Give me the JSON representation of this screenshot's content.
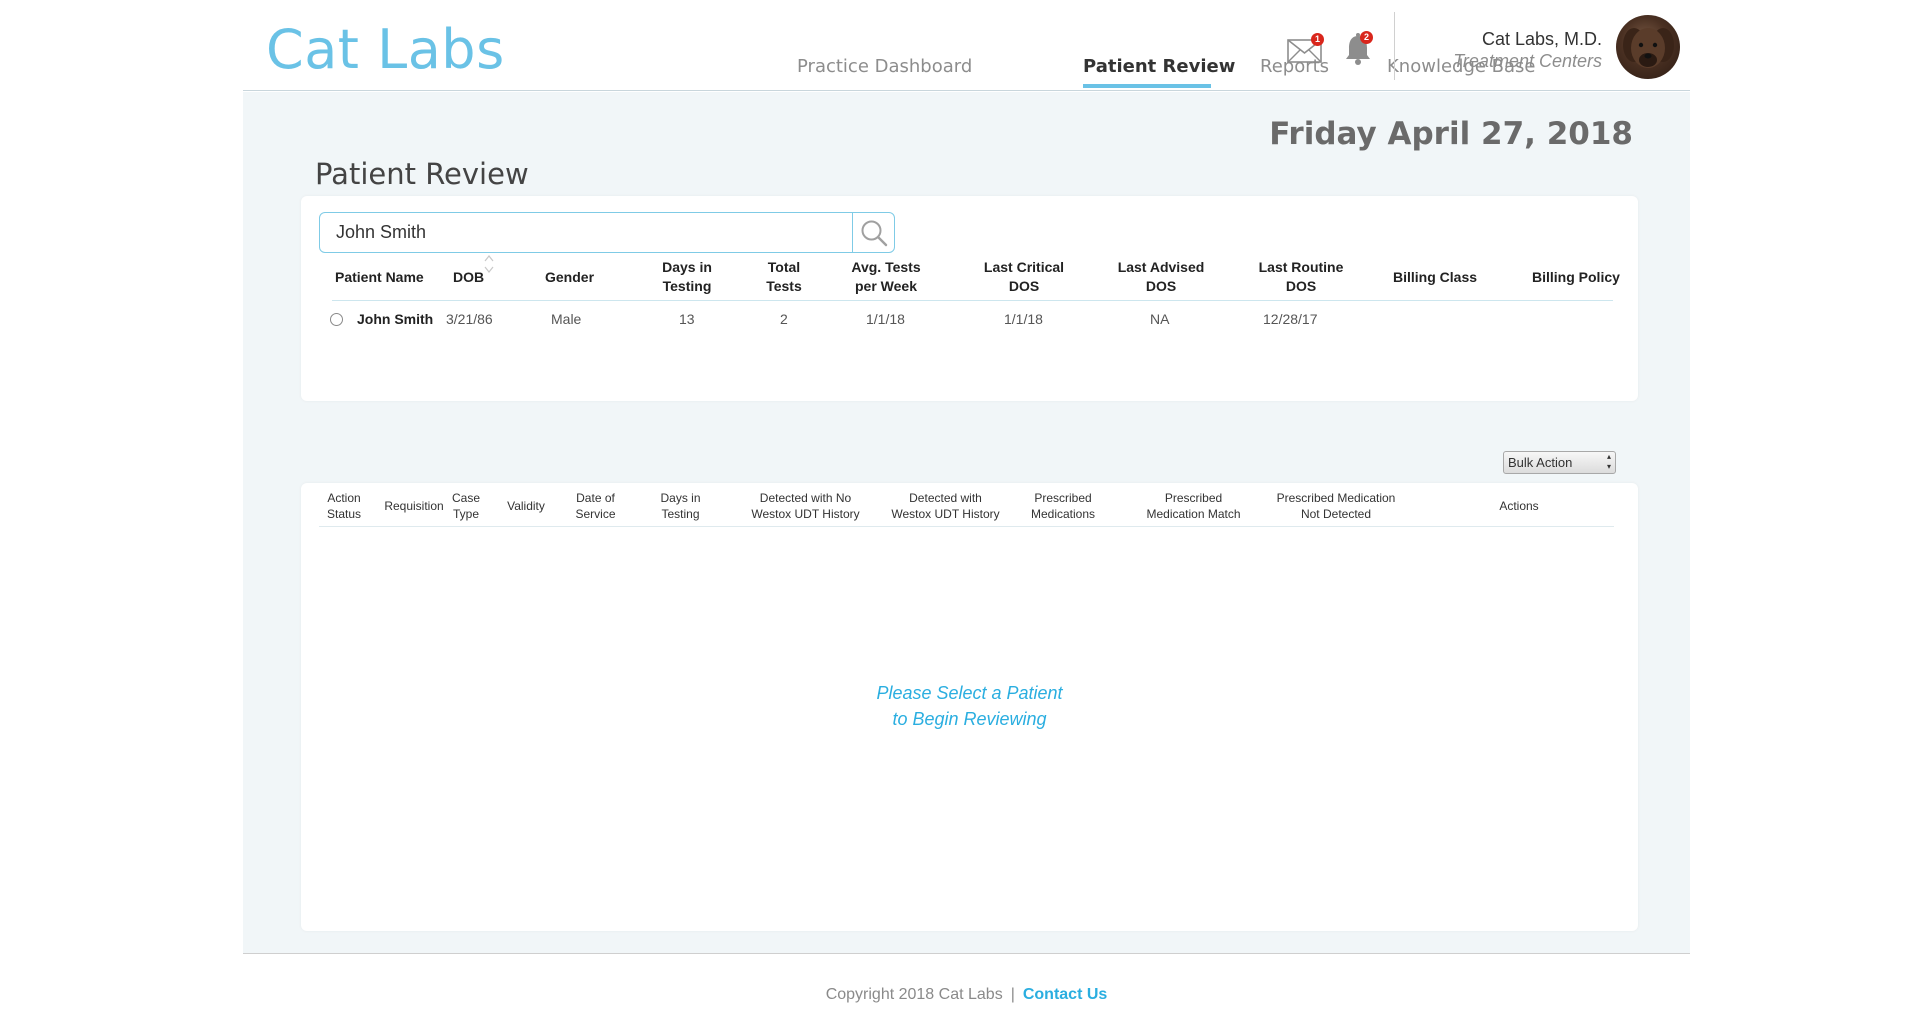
{
  "header": {
    "logo": "Cat Labs",
    "nav": [
      {
        "label": "Practice Dashboard"
      },
      {
        "label": "Patient Review"
      },
      {
        "label": "Reports"
      },
      {
        "label": "Knowledge Base"
      }
    ],
    "mail_badge": "1",
    "bell_badge": "2",
    "user_name": "Cat Labs, M.D.",
    "user_subtitle": "Treatment Centers",
    "accent_color": "#6ac2e6",
    "badge_color": "#d9261c"
  },
  "main": {
    "date": "Friday April 27, 2018",
    "title": "Patient Review",
    "search": {
      "value": "John Smith",
      "placeholder": ""
    },
    "patient_table": {
      "headers": [
        "Patient Name",
        "DOB",
        "Gender",
        "Days in\nTesting",
        "Total\nTests",
        "Avg. Tests\nper Week",
        "Last Critical\nDOS",
        "Last Advised\nDOS",
        "Last Routine\nDOS",
        "Billing Class",
        "Billing Policy"
      ],
      "rows": [
        {
          "name": "John Smith",
          "dob": "3/21/86",
          "gender": "Male",
          "days": "13",
          "total": "2",
          "avg": "1/1/18",
          "critical": "1/1/18",
          "advised": "NA",
          "routine": "12/28/17",
          "billing_class": "",
          "billing_policy": ""
        }
      ]
    },
    "bulk_action": "Bulk Action",
    "review_table": {
      "headers": [
        "Action\nStatus",
        "Requisition",
        "Case\nType",
        "Validity",
        "Date of\nService",
        "Days in\nTesting",
        "Detected with No\nWestox UDT History",
        "Detected with\nWestox UDT History",
        "Prescribed\nMedications",
        "Prescribed\nMedication Match",
        "Prescribed Medication\nNot Detected",
        "Actions"
      ]
    },
    "empty_message_line1": "Please Select a Patient",
    "empty_message_line2": "to Begin Reviewing"
  },
  "footer": {
    "copyright": "Copyright 2018 Cat Labs",
    "separator": "|",
    "contact": "Contact Us"
  }
}
